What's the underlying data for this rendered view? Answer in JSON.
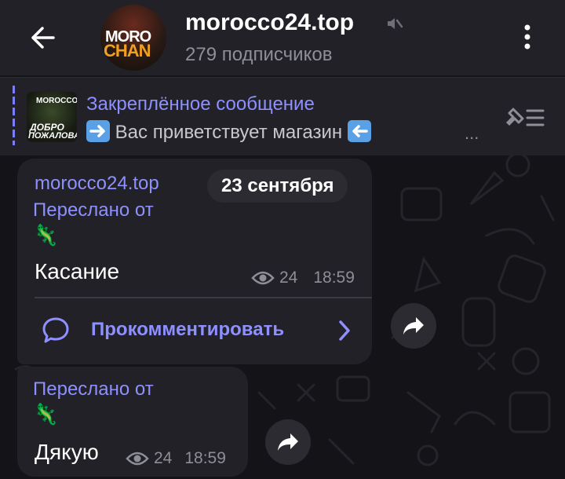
{
  "header": {
    "channel_title": "morocco24.top",
    "subscribers": "279 подписчиков",
    "avatar_line1": "MORO",
    "avatar_line2": "CHAN"
  },
  "pinned": {
    "title": "Закреплённое сообщение",
    "text": "Вас приветствует магазин",
    "ellipsis": "...",
    "thumb_line1": "MOROCCO",
    "thumb_line2": "ДОБРО",
    "thumb_line3": "ПОЖАЛОВАТЬ"
  },
  "messages": [
    {
      "sender": "morocco24.top",
      "forwarded_label": "Переслано от",
      "forwarded_from_emoji": "🦎",
      "text": "Касание",
      "views": "24",
      "time": "18:59",
      "comment_label": "Прокомментировать"
    },
    {
      "forwarded_label": "Переслано от",
      "forwarded_from_emoji": "🦎",
      "text": "Дякую",
      "views": "24",
      "time": "18:59"
    }
  ],
  "date_pill": "23 сентября",
  "colors": {
    "accent": "#8e90ff",
    "bubble": "#212127",
    "header": "#212127",
    "background": "#141418",
    "secondary_text": "#8e8e96"
  }
}
